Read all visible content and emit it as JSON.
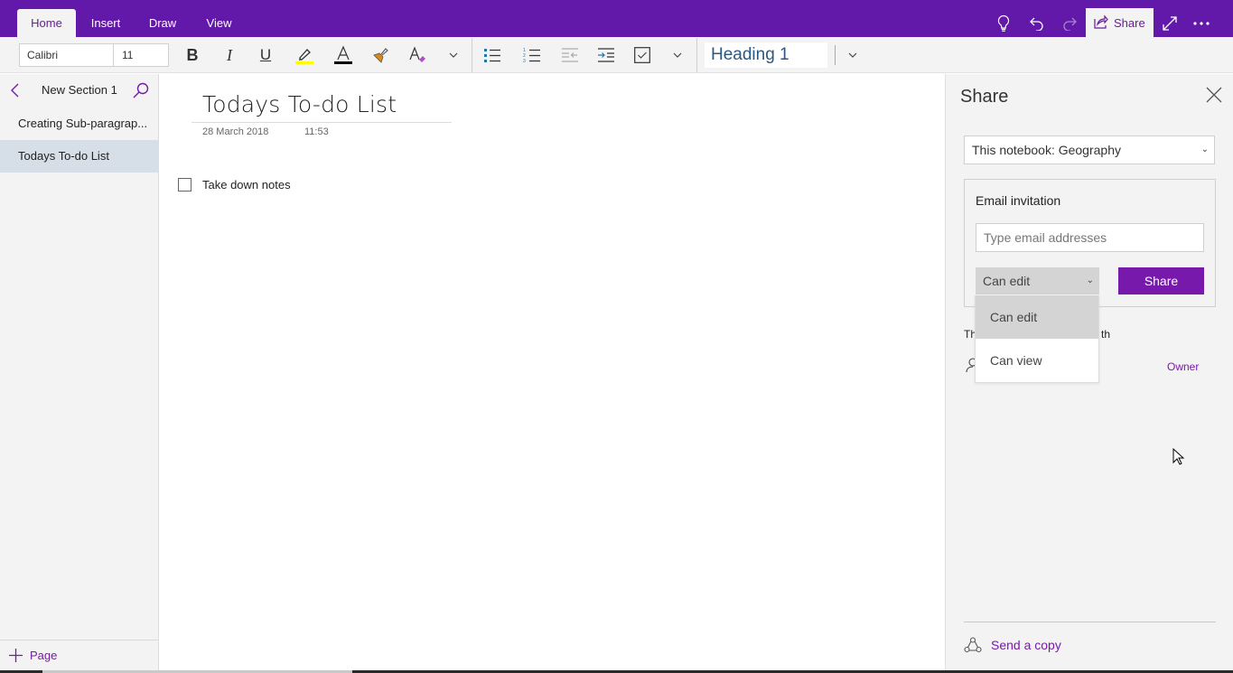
{
  "ribbon": {
    "tabs": [
      {
        "label": "Home",
        "active": true
      },
      {
        "label": "Insert",
        "active": false
      },
      {
        "label": "Draw",
        "active": false
      },
      {
        "label": "View",
        "active": false
      }
    ],
    "right_icons": [
      "lightbulb-icon",
      "undo-icon",
      "redo-icon",
      "share-icon",
      "expand-icon",
      "more-icon"
    ],
    "share_label": "Share"
  },
  "toolbar": {
    "font_name": "Calibri",
    "font_size": "11",
    "highlight_color": "#ffff00",
    "font_color": "#000000",
    "style": "Heading 1"
  },
  "left_pane": {
    "section_title": "New Section 1",
    "pages": [
      {
        "label": "Creating Sub-paragrap...",
        "selected": false
      },
      {
        "label": "Todays To-do List",
        "selected": true
      }
    ],
    "add_page_label": "Page"
  },
  "page": {
    "title": "Todays To-do List",
    "date": "28 March 2018",
    "time": "11:53",
    "todos": [
      {
        "text": "Take down notes",
        "checked": false
      }
    ]
  },
  "share_pane": {
    "title": "Share",
    "notebook_select": "This notebook: Geography",
    "email_invitation_label": "Email invitation",
    "email_placeholder": "Type email addresses",
    "permission_selected": "Can edit",
    "permission_options": [
      "Can edit",
      "Can view"
    ],
    "share_button": "Share",
    "shared_with_fragment_start": "Th",
    "shared_with_fragment_end": "th",
    "owner_label": "Owner",
    "send_copy_label": "Send a copy"
  },
  "colors": {
    "brand": "#6218a8",
    "accent": "#7719aa",
    "selected_page": "#d6dfe7"
  }
}
